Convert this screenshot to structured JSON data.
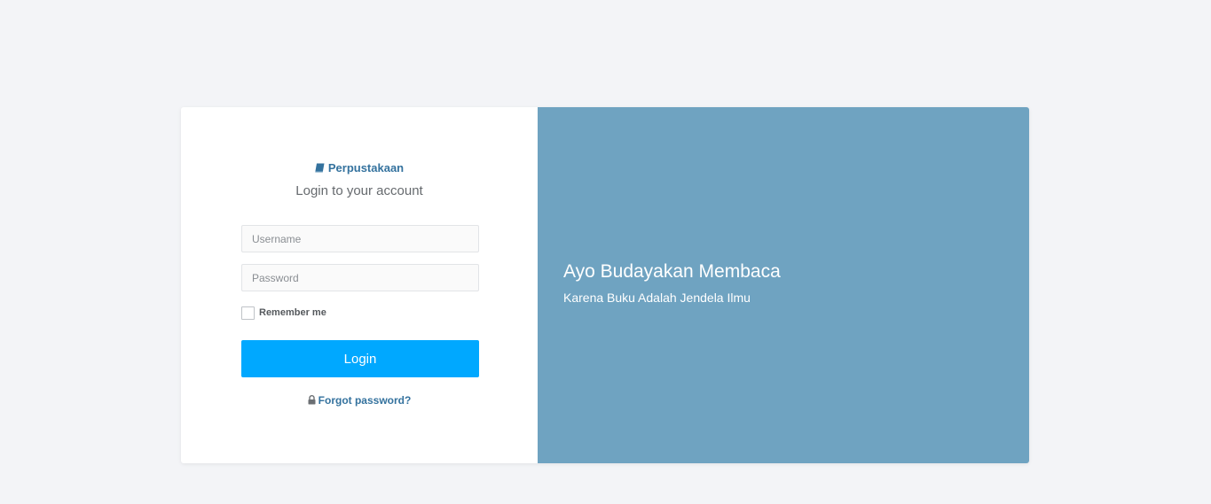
{
  "login_panel": {
    "brand_icon": "book-icon",
    "brand_name": "Perpustakaan",
    "subtitle": "Login to your account",
    "username_placeholder": "Username",
    "password_placeholder": "Password",
    "username_value": "",
    "password_value": "",
    "remember_label": "Remember me",
    "remember_checked": false,
    "login_label": "Login",
    "forgot_icon": "lock-icon",
    "forgot_label": "Forgot password?"
  },
  "hero_panel": {
    "headline": "Ayo Budayakan Membaca",
    "tagline": "Karena Buku Adalah Jendela Ilmu"
  },
  "colors": {
    "page_background": "#f3f4f7",
    "accent_button": "#00a8ff",
    "link": "#34729e",
    "hero_background": "#6fa3c1"
  }
}
